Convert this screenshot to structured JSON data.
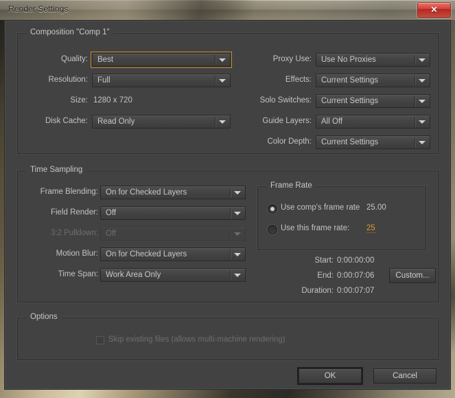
{
  "window": {
    "title": "Render Settings",
    "close_label": "✕"
  },
  "composition": {
    "group_title": "Composition \"Comp 1\"",
    "left_fields": [
      {
        "label": "Quality:",
        "value": "Best",
        "focused": true,
        "disabled": false
      },
      {
        "label": "Resolution:",
        "value": "Full",
        "focused": false,
        "disabled": false
      },
      {
        "label": "Disk Cache:",
        "value": "Read Only",
        "focused": false,
        "disabled": false
      }
    ],
    "size_label": "Size:",
    "size_value": "1280 x 720",
    "right_fields": [
      {
        "label": "Proxy Use:",
        "value": "Use No Proxies",
        "disabled": false
      },
      {
        "label": "Effects:",
        "value": "Current Settings",
        "disabled": false
      },
      {
        "label": "Solo Switches:",
        "value": "Current Settings",
        "disabled": false
      },
      {
        "label": "Guide Layers:",
        "value": "All Off",
        "disabled": false
      },
      {
        "label": "Color Depth:",
        "value": "Current Settings",
        "disabled": false
      }
    ]
  },
  "time_sampling": {
    "group_title": "Time Sampling",
    "fields": [
      {
        "label": "Frame Blending:",
        "value": "On for Checked Layers",
        "disabled": false
      },
      {
        "label": "Field Render:",
        "value": "Off",
        "disabled": false
      },
      {
        "label": "3:2 Pulldown:",
        "value": "Off",
        "disabled": true
      },
      {
        "label": "Motion Blur:",
        "value": "On for Checked Layers",
        "disabled": false
      },
      {
        "label": "Time Span:",
        "value": "Work Area Only",
        "disabled": false
      }
    ]
  },
  "frame_rate": {
    "group_title": "Frame Rate",
    "use_comp_label": "Use comp's frame rate",
    "use_comp_value": "25.00",
    "use_comp_checked": true,
    "use_this_label": "Use this frame rate:",
    "use_this_value": "25",
    "use_this_checked": false
  },
  "time_info": {
    "start_label": "Start:",
    "start_value": "0:00:00:00",
    "end_label": "End:",
    "end_value": "0:00:07:06",
    "duration_label": "Duration:",
    "duration_value": "0:00:07:07",
    "custom_button": "Custom..."
  },
  "options": {
    "group_title": "Options",
    "skip_existing_label": "Skip existing files (allows multi-machine rendering)",
    "skip_existing_checked": false
  },
  "footer": {
    "ok_label": "OK",
    "cancel_label": "Cancel"
  },
  "colors": {
    "dialog_bg": "#424242",
    "focus_accent": "#c98a26",
    "value_accent": "#d79b36",
    "close_red": "#d3403a"
  }
}
